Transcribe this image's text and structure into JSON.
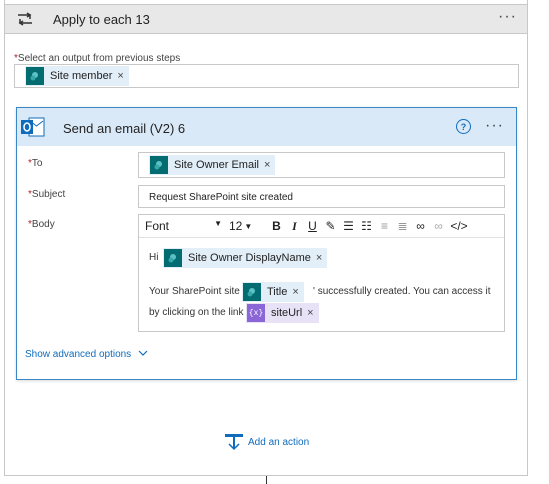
{
  "apply_each": {
    "title": "Apply to each 13",
    "more": "···",
    "select_label": "Select an output from previous steps",
    "required_mark": "*",
    "token": {
      "label": "Site member",
      "remove": "×"
    }
  },
  "email": {
    "title": "Send an email (V2) 6",
    "help": "?",
    "more": "···",
    "to": {
      "label": "To",
      "token": "Site Owner Email",
      "remove": "×"
    },
    "subject": {
      "label": "Subject",
      "value": "Request SharePoint site created"
    },
    "body": {
      "label": "Body",
      "toolbar": {
        "font": "Font",
        "size": "12"
      },
      "greeting": "Hi",
      "owner_token": "Site Owner DisplayName",
      "line2_prefix": "Your SharePoint site '",
      "title_token": "Title",
      "line2_suffix": "' successfully created. You can access it",
      "line3_prefix": "by clicking on the link",
      "url_token": "siteUrl",
      "url_icon": "{x}",
      "remove": "×"
    },
    "advanced": "Show advanced options"
  },
  "add_action": "Add an action",
  "colors": {
    "accent": "#0f6cbd",
    "sharepoint": "#036c70",
    "expression": "#8a66d6",
    "header_bg": "#dae9f7",
    "card_border": "#3a87c8"
  }
}
